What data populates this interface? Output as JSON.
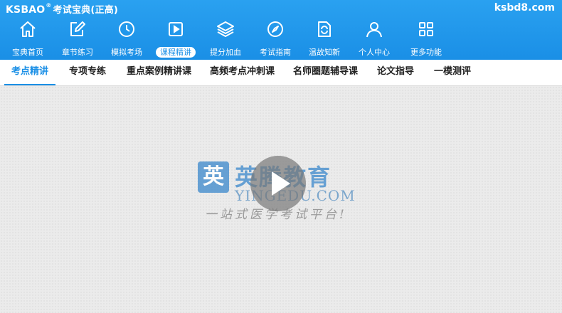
{
  "header": {
    "brand": "KSBAO",
    "brand_mark": "®",
    "brand_cn": "考试宝典(正高)",
    "domain": "ksbd8.com"
  },
  "nav": {
    "items": [
      {
        "label": "宝典首页",
        "icon": "home-icon"
      },
      {
        "label": "章节练习",
        "icon": "edit-icon"
      },
      {
        "label": "模拟考场",
        "icon": "clock-icon"
      },
      {
        "label": "课程精讲",
        "icon": "play-icon",
        "active": true
      },
      {
        "label": "提分加血",
        "icon": "layers-icon"
      },
      {
        "label": "考试指南",
        "icon": "compass-icon"
      },
      {
        "label": "温故知新",
        "icon": "refresh-doc-icon"
      },
      {
        "label": "个人中心",
        "icon": "user-icon"
      },
      {
        "label": "更多功能",
        "icon": "grid-icon"
      }
    ]
  },
  "subtabs": [
    {
      "label": "考点精讲",
      "active": true
    },
    {
      "label": "专项专练"
    },
    {
      "label": "重点案例精讲课"
    },
    {
      "label": "高频考点冲刺课"
    },
    {
      "label": "名师圈题辅导课"
    },
    {
      "label": "论文指导"
    },
    {
      "label": "一模测评"
    }
  ],
  "video": {
    "watermark_logo_char": "英",
    "watermark_title": "英腾教育",
    "watermark_url": "YINGEDU.COM",
    "watermark_slogan": "一站式医学考试平台!"
  },
  "colors": {
    "accent": "#1a8fe6",
    "header_bg": "#2aa1f0",
    "watermark": "#4f93cf"
  }
}
